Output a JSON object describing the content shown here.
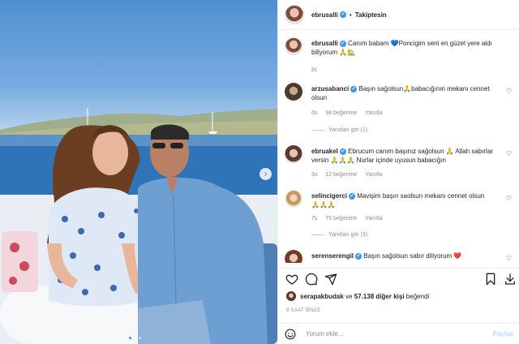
{
  "header": {
    "username": "ebrusalli",
    "separator": "•",
    "follow_label": "Takiptesin"
  },
  "caption": {
    "username": "ebrusalli",
    "text": "Canım babam 💙Poncigim seni en güzel yere aldı biliyorum 🙏🏡",
    "time": "8c"
  },
  "comments": [
    {
      "username": "arzusabanci",
      "verified": true,
      "text": "Başın sağolsun🙏babacığının mekanı cennet olsun",
      "time": "6s",
      "likes": "34 beğenme",
      "reply_label": "Yanıtla",
      "view_replies": "Yanıtları gör (1)"
    },
    {
      "username": "ebruakel",
      "verified": true,
      "text": "Ebrucum canım başınız sağolsun 🙏 Allah sabırlar versin 🙏🙏🙏 Nurlar içinde uyusun babacığın",
      "time": "3s",
      "likes": "12 beğenme",
      "reply_label": "Yanıtla",
      "view_replies": ""
    },
    {
      "username": "selincigerci",
      "verified": true,
      "text": "Mavişim başın saolsun mekanı cennet olsun 🙏🙏🙏",
      "time": "7s",
      "likes": "75 beğenme",
      "reply_label": "Yanıtla",
      "view_replies": "Yanıtları gör (3)"
    },
    {
      "username": "serenserengil",
      "verified": true,
      "text": "Başın sağolsun sabır diliyorum ❤️",
      "time": "",
      "likes": "",
      "reply_label": "",
      "view_replies": ""
    }
  ],
  "likes": {
    "first_user": "serapakbudak",
    "connector": "ve",
    "others": "57.138 diğer kişi",
    "suffix": "beğendi"
  },
  "post_time": "8 SAAT ÖNCE",
  "add_comment": {
    "placeholder": "Yorum ekle...",
    "post_label": "Paylaş"
  },
  "icons": {
    "verified": "✔",
    "heart_small": "♡",
    "next": "›"
  },
  "colors": {
    "accent": "#3897f0",
    "post_disabled": "#b2dffc",
    "muted": "#8e8e8e",
    "text": "#262626"
  },
  "carousel": {
    "current_slide": 1,
    "slide_count": 3
  }
}
